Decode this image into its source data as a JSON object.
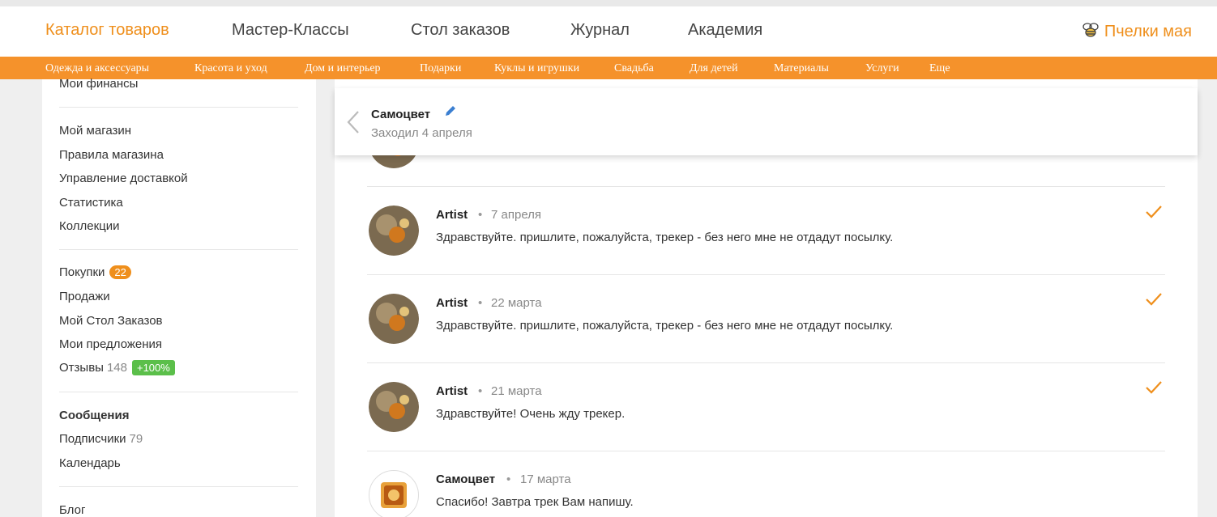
{
  "topnav": {
    "items": [
      "Каталог товаров",
      "Мастер-Классы",
      "Стол заказов",
      "Журнал",
      "Академия"
    ],
    "user": "Пчелки мая",
    "accent": "#ef8f1c"
  },
  "catbar": {
    "items": [
      "Одежда и аксессуары",
      "Красота и уход",
      "Дом и интерьер",
      "Подарки",
      "Куклы и игрушки",
      "Свадьба",
      "Для детей",
      "Материалы",
      "Услуги",
      "Еще"
    ],
    "color": "#f5922b"
  },
  "sidebar": {
    "finances": "Мои финансы",
    "shop": [
      "Мой магазин",
      "Правила магазина",
      "Управление доставкой",
      "Статистика",
      "Коллекции"
    ],
    "purchases": "Покупки",
    "purchases_badge": "22",
    "sales": "Продажи",
    "orders": "Мой Стол Заказов",
    "offers": "Мои предложения",
    "reviews": "Отзывы",
    "reviews_count": "148",
    "reviews_badge": "+100%",
    "messages": "Сообщения",
    "subscribers": "Подписчики",
    "subscribers_count": "79",
    "calendar": "Календарь",
    "blog": "Блог"
  },
  "chat": {
    "name": "Самоцвет",
    "last_seen": "Заходил 4 апреля",
    "messages": [
      {
        "author": "Artist",
        "date": "7 апреля",
        "text": "Здравствуйте. пришлите, пожалуйста, трекер - без него мне не отдадут посылку.",
        "read": true
      },
      {
        "author": "Artist",
        "date": "22 марта",
        "text": "Здравствуйте. пришлите, пожалуйста, трекер - без него мне не отдадут посылку.",
        "read": true
      },
      {
        "author": "Artist",
        "date": "21 марта",
        "text": "Здравствуйте! Очень жду трекер.",
        "read": true
      },
      {
        "author": "Самоцвет",
        "date": "17 марта",
        "text": "Спасибо! Завтра трек Вам напишу.",
        "read": false
      }
    ],
    "dot": "•"
  }
}
